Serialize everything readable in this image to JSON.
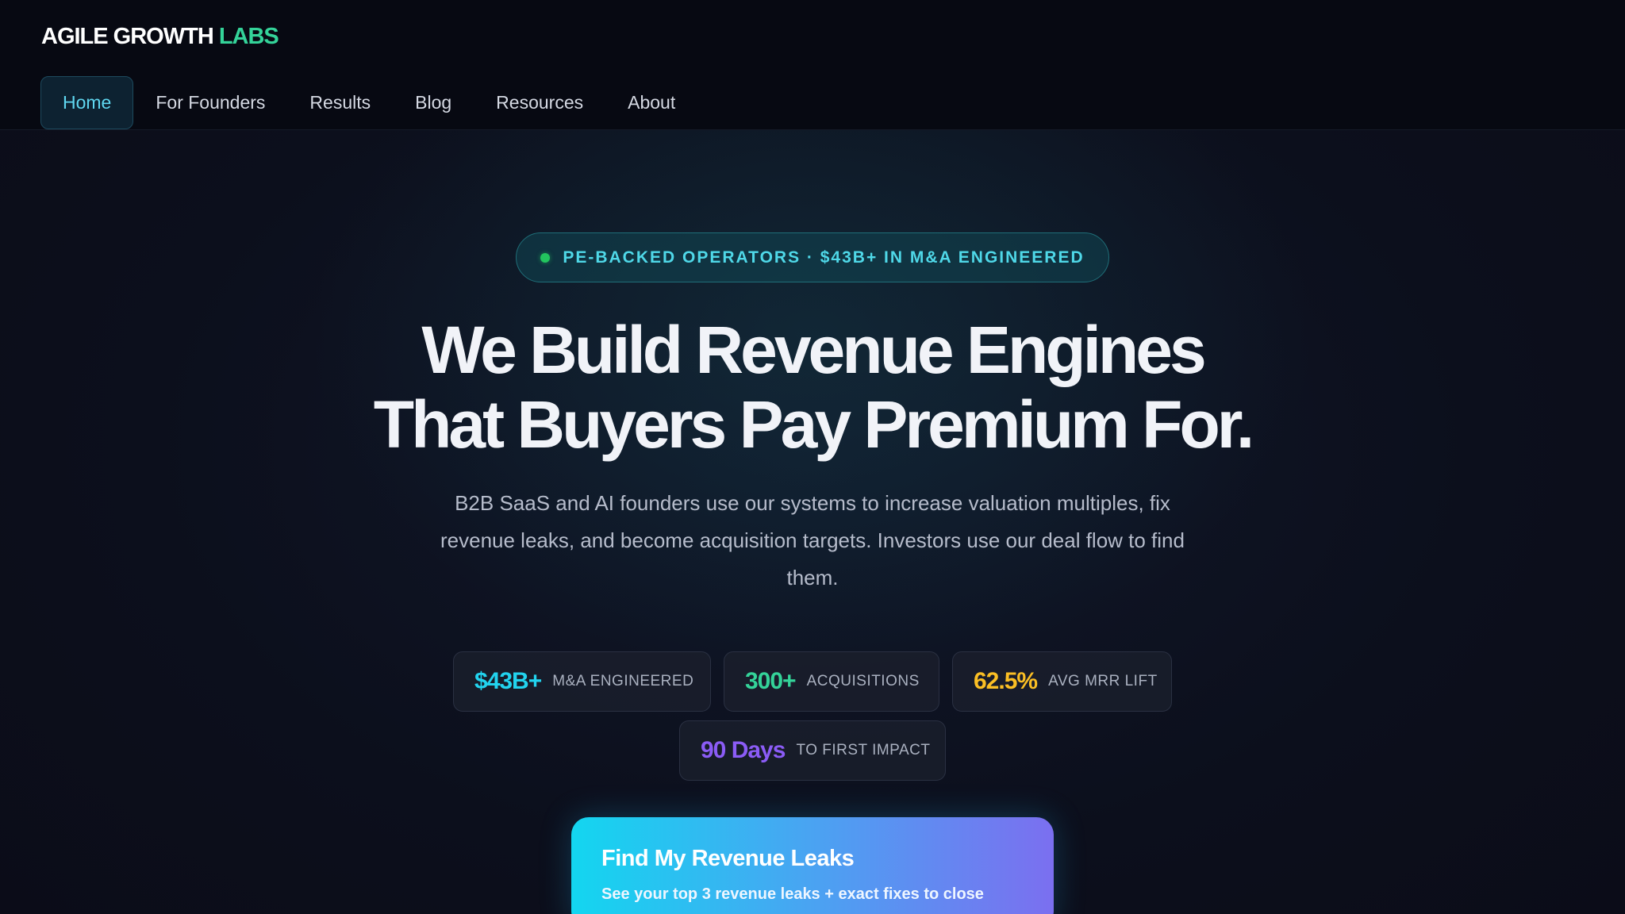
{
  "brand": {
    "name_main": "AGILE GROWTH",
    "name_accent": "LABS",
    "accent_color": "#34d399"
  },
  "nav": {
    "items": [
      {
        "label": "Home",
        "active": true
      },
      {
        "label": "For Founders",
        "active": false
      },
      {
        "label": "Results",
        "active": false
      },
      {
        "label": "Blog",
        "active": false
      },
      {
        "label": "Resources",
        "active": false
      },
      {
        "label": "About",
        "active": false
      }
    ]
  },
  "hero": {
    "badge": "PE-BACKED OPERATORS · $43B+ IN M&A ENGINEERED",
    "headline_line1": "We Build Revenue Engines",
    "headline_line2": "That Buyers Pay Premium For.",
    "subhead": "B2B SaaS and AI founders use our systems to increase valuation multiples, fix revenue leaks, and become acquisition targets. Investors use our deal flow to find them."
  },
  "stats": [
    {
      "value": "$43B+",
      "label": "M&A ENGINEERED",
      "color": "#22d3ee"
    },
    {
      "value": "300+",
      "label": "ACQUISITIONS",
      "color": "#34d399"
    },
    {
      "value": "62.5%",
      "label": "AVG MRR LIFT",
      "color": "#fbbf24"
    },
    {
      "value": "90 Days",
      "label": "TO FIRST IMPACT",
      "color": "#8b5cf6"
    }
  ],
  "cta": {
    "title": "Find My Revenue Leaks",
    "subtitle": "See your top 3 revenue leaks + exact fixes to close"
  }
}
